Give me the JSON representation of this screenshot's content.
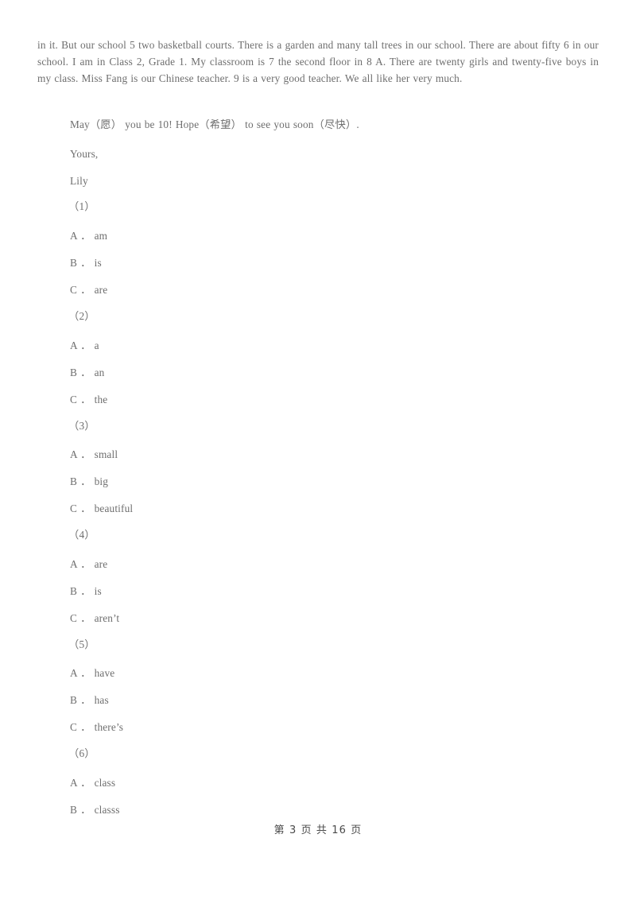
{
  "document": {
    "passage": "in it. But our school 5 two basketball courts. There is a garden and many tall trees in our school. There are about fifty 6 in our school. I am in Class 2, Grade 1. My classroom is 7 the second floor in 8 A. There are twenty girls and twenty-five boys in my class. Miss Fang is our Chinese teacher. 9 is a very good teacher. We all like her very much.",
    "closing": {
      "wish": "May（愿） you be 10! Hope（希望） to see you soon（尽快）.",
      "signoff": "Yours,",
      "signature": "Lily"
    },
    "questions": [
      {
        "number": "（1）",
        "options": [
          "A ． am",
          "B ． is",
          "C ． are"
        ]
      },
      {
        "number": "（2）",
        "options": [
          "A ． a",
          "B ． an",
          "C ． the"
        ]
      },
      {
        "number": "（3）",
        "options": [
          "A ． small",
          "B ． big",
          "C ． beautiful"
        ]
      },
      {
        "number": "（4）",
        "options": [
          "A ． are",
          "B ． is",
          "C ． aren’t"
        ]
      },
      {
        "number": "（5）",
        "options": [
          "A ． have",
          "B ． has",
          "C ． there’s"
        ]
      },
      {
        "number": "（6）",
        "options": [
          "A ． class",
          "B ． classs"
        ]
      }
    ],
    "footer": "第 3 页 共 16 页"
  }
}
